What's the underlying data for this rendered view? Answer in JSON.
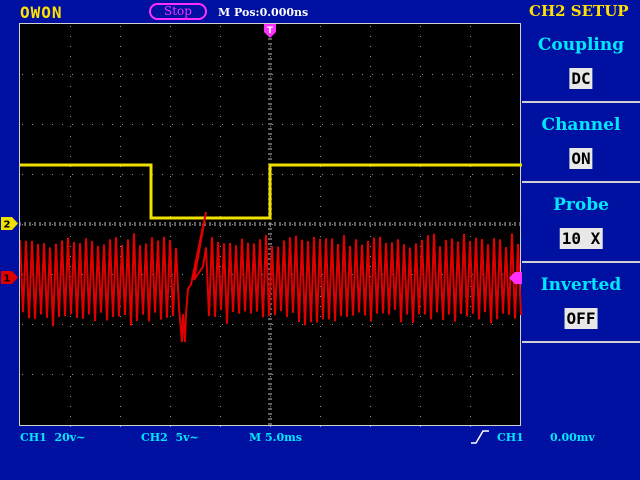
{
  "header": {
    "brand": "OWON",
    "run_state": "Stop",
    "m_pos": "M Pos:0.000ns",
    "menu_title": "CH2 SETUP"
  },
  "menu": {
    "items": [
      {
        "label": "Coupling",
        "value": "DC"
      },
      {
        "label": "Channel",
        "value": "ON"
      },
      {
        "label": "Probe",
        "value": "10 X"
      },
      {
        "label": "Inverted",
        "value": "OFF"
      }
    ]
  },
  "status": {
    "ch1": "CH1  20v~",
    "ch2": "CH2  5v~",
    "timebase": "M 5.0ms",
    "trigger_source": "CH1",
    "trigger_level": "0.00mv"
  },
  "markers": {
    "ch1": "1",
    "ch2": "2",
    "trigger": "T"
  },
  "colors": {
    "background": "#0010a0",
    "ch1_trace": "#e00000",
    "ch2_trace": "#f0e000",
    "menu_label": "#00e8ff",
    "brand": "#ffe000",
    "trigger": "#ff30ff"
  }
}
